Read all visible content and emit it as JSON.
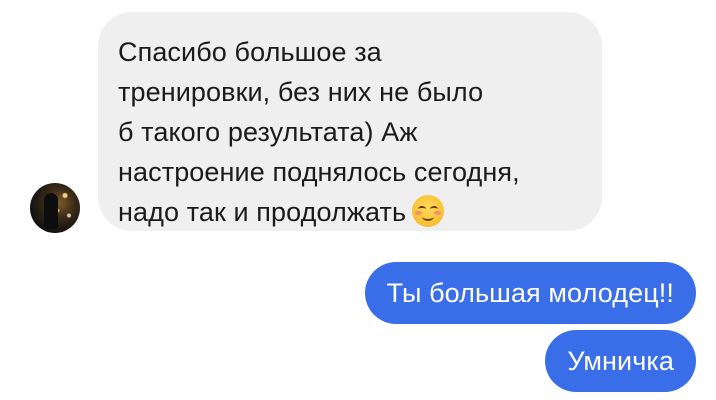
{
  "conversation": {
    "incoming": {
      "lines": [
        "Спасибо большое за",
        "тренировки, без них не было",
        "б такого результата) Аж",
        "настроение поднялось сегодня,",
        "надо так и продолжать"
      ],
      "emoji": "smiling-face-with-smiling-eyes",
      "bubble_color": "#efefef",
      "text_color": "#1b1b1b"
    },
    "outgoing": [
      {
        "text": "Ты большая молодец!!"
      },
      {
        "text": "Умничка"
      }
    ],
    "outgoing_bubble_color": "#3a6ee8",
    "outgoing_text_color": "#ffffff"
  }
}
